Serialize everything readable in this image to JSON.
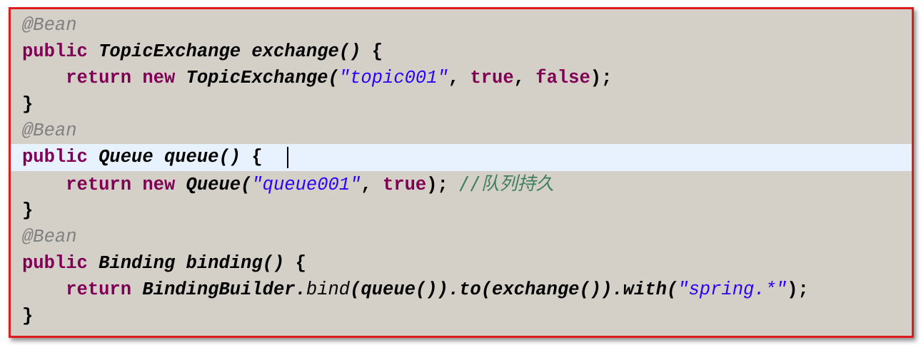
{
  "editor": {
    "lines": [
      {
        "id": "l1",
        "tokens": [
          {
            "cls": "ann",
            "text": "@Bean"
          }
        ]
      },
      {
        "id": "l2",
        "tokens": [
          {
            "cls": "kw",
            "text": "public "
          },
          {
            "cls": "type",
            "text": "TopicExchange "
          },
          {
            "cls": "method",
            "text": "exchange() "
          },
          {
            "cls": "punct",
            "text": "{"
          }
        ]
      },
      {
        "id": "l3",
        "tokens": [
          {
            "cls": "punct",
            "text": "    "
          },
          {
            "cls": "kw",
            "text": "return new "
          },
          {
            "cls": "type",
            "text": "TopicExchange("
          },
          {
            "cls": "str",
            "text": "\"topic001\""
          },
          {
            "cls": "punct",
            "text": ", "
          },
          {
            "cls": "lit",
            "text": "true"
          },
          {
            "cls": "punct",
            "text": ", "
          },
          {
            "cls": "lit",
            "text": "false"
          },
          {
            "cls": "punct",
            "text": ");"
          }
        ]
      },
      {
        "id": "l4",
        "tokens": [
          {
            "cls": "punct",
            "text": "}"
          }
        ]
      },
      {
        "id": "l5",
        "tokens": [
          {
            "cls": "ann",
            "text": "@Bean"
          }
        ]
      },
      {
        "id": "l6",
        "highlight": true,
        "caret": true,
        "tokens": [
          {
            "cls": "kw",
            "text": "public "
          },
          {
            "cls": "type",
            "text": "Queue "
          },
          {
            "cls": "method",
            "text": "queue() "
          },
          {
            "cls": "punct",
            "text": "{  "
          }
        ]
      },
      {
        "id": "l7",
        "tokens": [
          {
            "cls": "punct",
            "text": "    "
          },
          {
            "cls": "kw",
            "text": "return new "
          },
          {
            "cls": "type",
            "text": "Queue("
          },
          {
            "cls": "str",
            "text": "\"queue001\""
          },
          {
            "cls": "punct",
            "text": ", "
          },
          {
            "cls": "lit",
            "text": "true"
          },
          {
            "cls": "punct",
            "text": "); "
          },
          {
            "cls": "comment",
            "text": "//队列持久"
          }
        ]
      },
      {
        "id": "l8",
        "tokens": [
          {
            "cls": "punct",
            "text": "}"
          }
        ]
      },
      {
        "id": "l9",
        "tokens": [
          {
            "cls": "ann",
            "text": "@Bean"
          }
        ]
      },
      {
        "id": "l10",
        "tokens": [
          {
            "cls": "kw",
            "text": "public "
          },
          {
            "cls": "type",
            "text": "Binding "
          },
          {
            "cls": "method",
            "text": "binding() "
          },
          {
            "cls": "punct",
            "text": "{"
          }
        ]
      },
      {
        "id": "l11",
        "tokens": [
          {
            "cls": "punct",
            "text": "    "
          },
          {
            "cls": "kw",
            "text": "return "
          },
          {
            "cls": "type",
            "text": "BindingBuilder."
          },
          {
            "cls": "static-call",
            "text": "bind"
          },
          {
            "cls": "method",
            "text": "(queue()).to(exchange()).with("
          },
          {
            "cls": "str",
            "text": "\"spring.*\""
          },
          {
            "cls": "punct",
            "text": ");"
          }
        ]
      },
      {
        "id": "l12",
        "tokens": [
          {
            "cls": "punct",
            "text": "}"
          }
        ]
      }
    ]
  }
}
